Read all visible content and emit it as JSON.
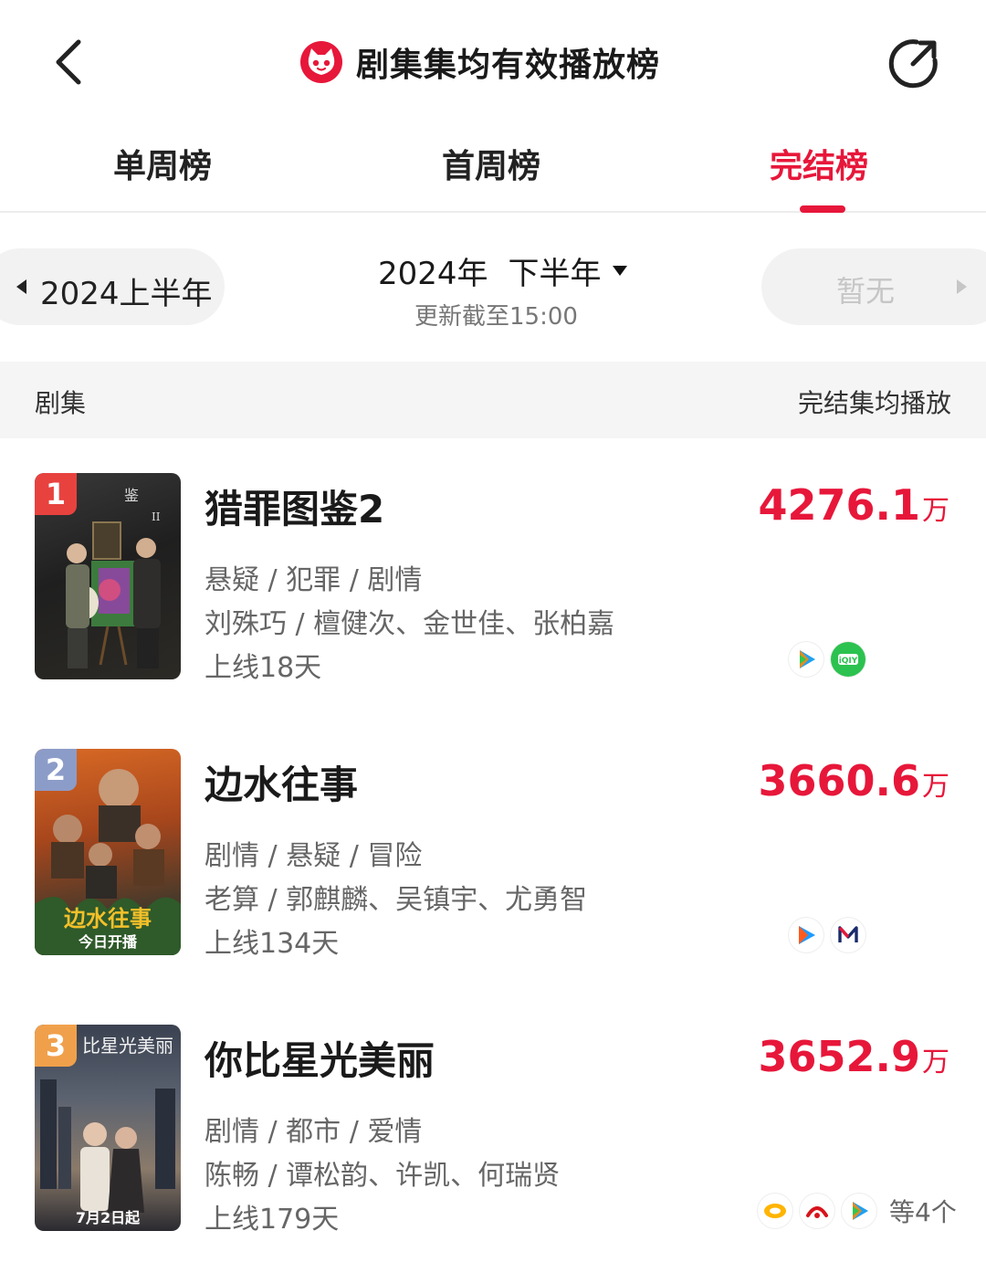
{
  "header": {
    "title": "剧集集均有效播放榜",
    "back_icon": "back-arrow-icon",
    "share_icon": "share-icon",
    "logo_icon": "maoyan-cat-logo"
  },
  "tabs": [
    {
      "label": "单周榜",
      "active": false
    },
    {
      "label": "首周榜",
      "active": false
    },
    {
      "label": "完结榜",
      "active": true
    }
  ],
  "period": {
    "prev_label": "2024上半年",
    "current_year": "2024年",
    "current_half": "下半年",
    "update_note": "更新截至15:00",
    "next_label": "暂无"
  },
  "list_header": {
    "left": "剧集",
    "right": "完结集均播放"
  },
  "shows": [
    {
      "rank": "1",
      "title": "猎罪图鉴2",
      "genres": "悬疑 / 犯罪 / 剧情",
      "cast": "刘殊巧 / 檀健次、金世佳、张柏嘉",
      "online": "上线18天",
      "plays": "4276.1",
      "unit": "万",
      "poster_caption": "",
      "platforms": [
        "tencent-video-icon",
        "iqiyi-icon"
      ],
      "platforms_more": ""
    },
    {
      "rank": "2",
      "title": "边水往事",
      "genres": "剧情 / 悬疑 / 冒险",
      "cast": "老算 / 郭麒麟、吴镇宇、尤勇智",
      "online": "上线134天",
      "plays": "3660.6",
      "unit": "万",
      "poster_caption": "今日开播",
      "platforms": [
        "youku-icon",
        "migu-icon"
      ],
      "platforms_more": ""
    },
    {
      "rank": "3",
      "title": "你比星光美丽",
      "genres": "剧情 / 都市 / 爱情",
      "cast": "陈畅 / 谭松韵、许凯、何瑞贤",
      "online": "上线179天",
      "plays": "3652.9",
      "unit": "万",
      "poster_caption": "7月2日起",
      "platforms": [
        "mango-tv-icon",
        "cctv-icon",
        "tencent-video-icon"
      ],
      "platforms_more": "等4个"
    }
  ],
  "colors": {
    "accent": "#e7173a",
    "rank1": "#e8423f",
    "rank2": "#8c9cc8",
    "rank3": "#f0a04b"
  }
}
